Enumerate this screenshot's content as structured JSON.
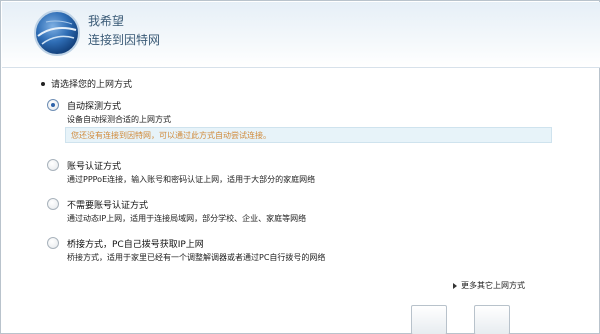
{
  "header": {
    "title": "我希望",
    "subtitle": "连接到因特网"
  },
  "section": {
    "heading": "请选择您的上网方式"
  },
  "options": [
    {
      "label": "自动探测方式",
      "description": "设备自动探测合适的上网方式",
      "hint": "您还没有连接到因特网，可以通过此方式自动尝试连接。",
      "selected": true
    },
    {
      "label": "账号认证方式",
      "description": "通过PPPoE连接，输入账号和密码认证上网，适用于大部分的家庭网络",
      "selected": false
    },
    {
      "label": "不需要账号认证方式",
      "description": "通过动态IP上网，适用于连接局域网，部分学校、企业、家庭等网络",
      "selected": false
    },
    {
      "label": "桥接方式，PC自己拨号获取IP上网",
      "description": "桥接方式，适用于家里已经有一个调整解调器或者通过PC自行拨号的网络",
      "selected": false
    }
  ],
  "more_link": "更多其它上网方式",
  "colors": {
    "accent": "#2f63a9",
    "hint_text": "#d08a3a",
    "hint_bg": "#e7f3f9",
    "header_text": "#3a5a76"
  },
  "icons": {
    "logo": "globe-icon",
    "bullet": "bullet-dot-icon",
    "more": "triangle-right-icon"
  }
}
